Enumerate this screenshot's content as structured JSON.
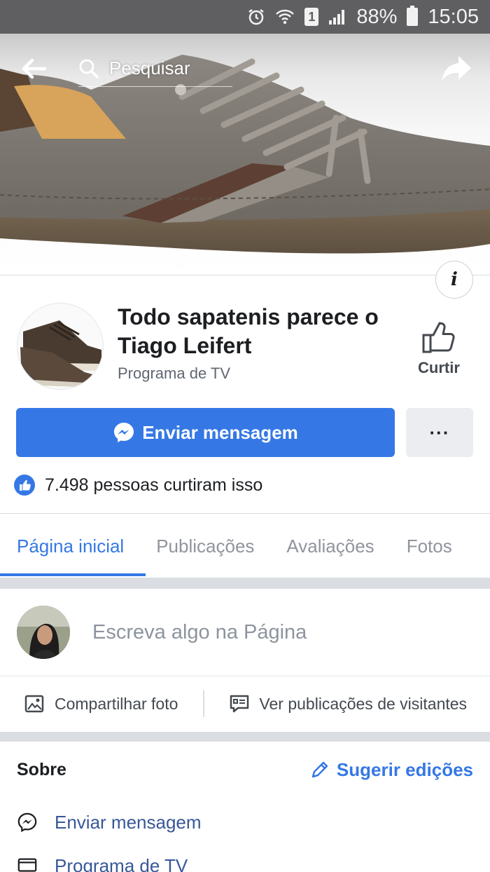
{
  "status_bar": {
    "sim_slot": "1",
    "battery": "88%",
    "time": "15:05"
  },
  "header": {
    "search_placeholder": "Pesquisar"
  },
  "page": {
    "name": "Todo sapatenis parece o Tiago Leifert",
    "category": "Programa de TV",
    "like_label": "Curtir",
    "message_button": "Enviar mensagem",
    "more_button": "···",
    "likes_text": "7.498 pessoas curtiram isso"
  },
  "tabs": [
    {
      "label": "Página inicial",
      "active": true
    },
    {
      "label": "Publicações",
      "active": false
    },
    {
      "label": "Avaliações",
      "active": false
    },
    {
      "label": "Fotos",
      "active": false
    }
  ],
  "composer": {
    "placeholder": "Escreva algo na Página",
    "share_photo": "Compartilhar foto",
    "visitor_posts": "Ver publicações de visitantes"
  },
  "about": {
    "title": "Sobre",
    "suggest_edits": "Sugerir edições",
    "rows": [
      {
        "icon": "messenger-icon",
        "label": "Enviar mensagem"
      },
      {
        "icon": "tv-icon",
        "label": "Programa de TV"
      }
    ]
  },
  "colors": {
    "accent": "#3578e5",
    "status_bar": "#5f5f61",
    "divider": "#dadde1"
  }
}
